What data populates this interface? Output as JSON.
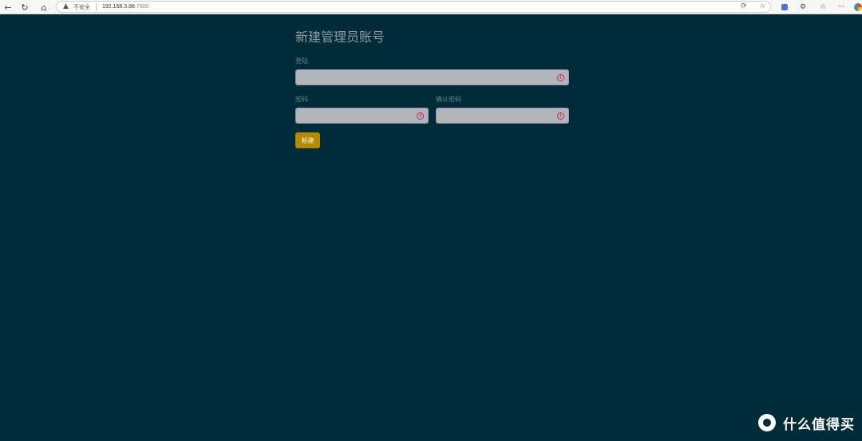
{
  "browser": {
    "back_icon": "←",
    "reload_icon": "↻",
    "home_icon": "⌂",
    "warning_icon": "▲",
    "security_label": "不安全",
    "url_host": "192.168.3.88",
    "url_port": ":7900",
    "translate_icon": "⟳",
    "star_icon": "☆",
    "extension_icon": "⚙",
    "favorites_icon": "☆",
    "more_icon": "···"
  },
  "form": {
    "title": "新建管理员账号",
    "login_label": "登陆",
    "password_label": "密码",
    "confirm_password_label": "确认密码",
    "login_value": "",
    "password_value": "",
    "confirm_password_value": "",
    "error_icon_glyph": "!",
    "submit_label": "新建"
  },
  "watermark": {
    "text": "什么值得买"
  },
  "colors": {
    "background": "#002b38",
    "field_background": "#b0b5ba",
    "error_accent": "#d2236a",
    "button_background": "#b58900"
  }
}
